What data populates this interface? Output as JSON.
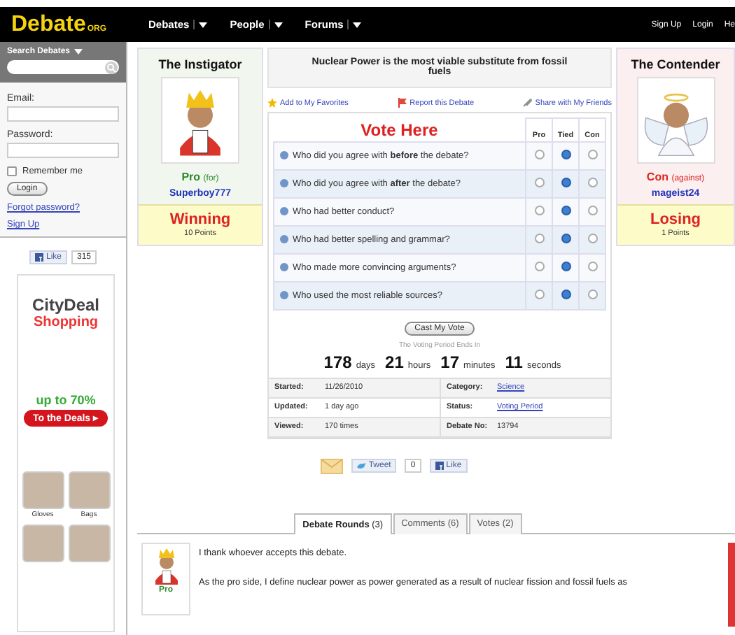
{
  "header": {
    "logo": "Debate",
    "logo_suffix": "ORG",
    "nav": [
      {
        "label": "Debates"
      },
      {
        "label": "People"
      },
      {
        "label": "Forums"
      }
    ],
    "links": [
      "Sign Up",
      "Login",
      "He"
    ]
  },
  "sidebar": {
    "search": {
      "label": "Search Debates"
    },
    "login": {
      "email_label": "Email:",
      "password_label": "Password:",
      "remember": {
        "label": "Remember me",
        "checked": false
      },
      "button": "Login",
      "links": [
        "Forgot password?",
        "Sign Up"
      ]
    },
    "like": {
      "label": "Like",
      "count": "315"
    },
    "ad": {
      "brand": "CityDeal",
      "subtitle": "Shopping",
      "offer": "up to 70%",
      "button": "To the Deals ▸",
      "products": [
        {
          "kind": "photo",
          "label": "Gloves"
        },
        {
          "kind": "photo",
          "label": "Bags"
        },
        {
          "kind": "photo"
        },
        {
          "kind": "photo"
        }
      ]
    }
  },
  "debate": {
    "instigator": {
      "heading": "The Instigator",
      "avatar": {
        "kind": "king"
      },
      "kind": "pro",
      "side_label": "Pro",
      "side_note": "(for)",
      "user": "Superboy777",
      "result": "Winning",
      "points": "10 Points"
    },
    "title": "Nuclear Power is the most viable substitute from fossil fuels",
    "actions": [
      {
        "kind": "star",
        "label": "Add to My Favorites"
      },
      {
        "kind": "flag",
        "label": "Report this Debate"
      },
      {
        "kind": "clip",
        "label": "Share with My Friends"
      }
    ],
    "vote": {
      "heading": "Vote Here",
      "columns": [
        "Pro",
        "Tied",
        "Con"
      ],
      "questions": [
        {
          "text": "Who did you agree with **before** the debate?",
          "options": [
            {
              "selected": false
            },
            {
              "selected": true
            },
            {
              "selected": false
            }
          ]
        },
        {
          "text": "Who did you agree with **after** the debate?",
          "options": [
            {
              "selected": false
            },
            {
              "selected": true
            },
            {
              "selected": false
            }
          ]
        },
        {
          "text": "Who had better conduct?",
          "options": [
            {
              "selected": false
            },
            {
              "selected": true
            },
            {
              "selected": false
            }
          ]
        },
        {
          "text": "Who had better spelling and grammar?",
          "options": [
            {
              "selected": false
            },
            {
              "selected": true
            },
            {
              "selected": false
            }
          ]
        },
        {
          "text": "Who made more convincing arguments?",
          "options": [
            {
              "selected": false
            },
            {
              "selected": true
            },
            {
              "selected": false
            }
          ]
        },
        {
          "text": "Who used the most reliable sources?",
          "options": [
            {
              "selected": false
            },
            {
              "selected": true
            },
            {
              "selected": false
            }
          ]
        }
      ],
      "button": "Cast My Vote",
      "period_label": "The Voting Period Ends In",
      "countdown": [
        {
          "value": "178",
          "unit": "days"
        },
        {
          "value": "21",
          "unit": "hours"
        },
        {
          "value": "17",
          "unit": "minutes"
        },
        {
          "value": "11",
          "unit": "seconds"
        }
      ]
    },
    "info": [
      [
        {
          "label": "Started:",
          "value": "11/26/2010",
          "link": false
        },
        {
          "label": "Category:",
          "value": "Science",
          "link": true
        }
      ],
      [
        {
          "label": "Updated:",
          "value": "1 day ago",
          "link": false
        },
        {
          "label": "Status:",
          "value": "Voting Period",
          "link": true
        }
      ],
      [
        {
          "label": "Viewed:",
          "value": "170 times",
          "link": false
        },
        {
          "label": "Debate No:",
          "value": "13794",
          "link": false
        }
      ]
    ],
    "contender": {
      "heading": "The Contender",
      "avatar": {
        "kind": "angel"
      },
      "kind": "con",
      "side_label": "Con",
      "side_note": "(against)",
      "user": "mageist24",
      "result": "Losing",
      "points": "1 Points"
    }
  },
  "share": {
    "tweet": "Tweet",
    "tweet_count": "0",
    "like": "Like"
  },
  "tabs": [
    {
      "label": "Debate Rounds",
      "count": "(3)",
      "selected": true
    },
    {
      "label": "Comments",
      "count": "(6)",
      "selected": false
    },
    {
      "label": "Votes",
      "count": "(2)",
      "selected": false
    }
  ],
  "round": {
    "avatar": {
      "kind": "king"
    },
    "side_label": "Pro",
    "paragraphs": [
      "I thank whoever accepts this debate.",
      "As the pro side, I define nuclear power as power generated as a result of nuclear fission and fossil fuels as"
    ]
  }
}
